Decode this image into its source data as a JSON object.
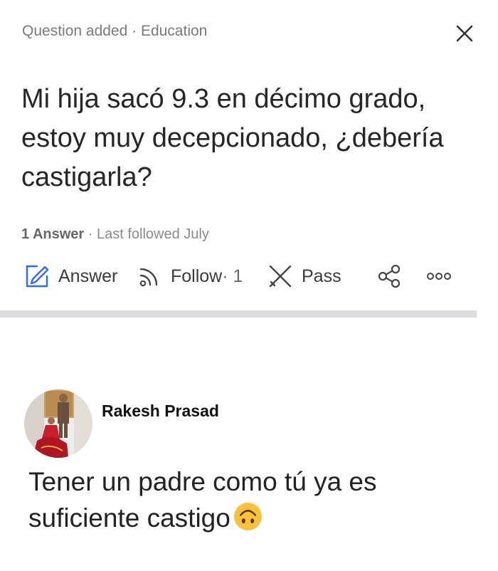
{
  "header": {
    "meta": "Question added · Education",
    "close_icon": "close-icon"
  },
  "question": {
    "title": "Mi hija sacó 9.3 en décimo grado, estoy muy decepcionado, ¿debería castigarla?",
    "answers_count": "1 Answer",
    "last_followed": " · Last followed July"
  },
  "actions": {
    "answer_label": "Answer",
    "follow_label": "Follow",
    "follow_count": " · 1",
    "pass_label": "Pass",
    "icons": [
      "answer-pen-icon",
      "follow-rss-icon",
      "pass-x-icon",
      "share-icon",
      "more-icon"
    ]
  },
  "answer": {
    "author": "Rakesh Prasad",
    "text": "Tener un padre como tú ya es suficiente castigo",
    "emoji": "upside-down-face-emoji"
  },
  "colors": {
    "accent_blue": "#2e69ff",
    "divider": "#dcdde0",
    "emoji_yellow": "#f7c23a"
  }
}
